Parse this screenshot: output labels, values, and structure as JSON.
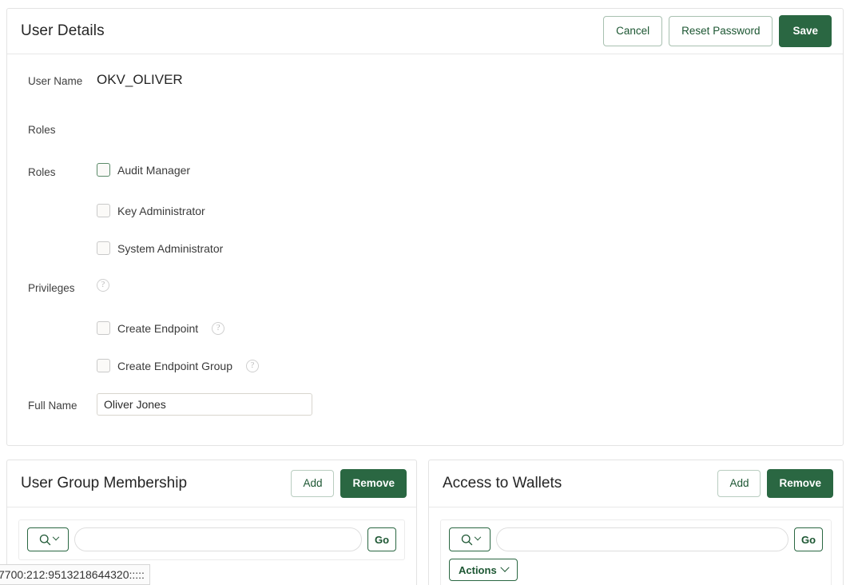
{
  "user_details": {
    "title": "User Details",
    "buttons": {
      "cancel": "Cancel",
      "reset_password": "Reset Password",
      "save": "Save"
    },
    "fields": {
      "user_name_label": "User Name",
      "user_name_value": "OKV_OLIVER",
      "roles_section_label": "Roles",
      "roles_label": "Roles",
      "privileges_label": "Privileges",
      "full_name_label": "Full Name",
      "full_name_value": "Oliver Jones",
      "full_name_placeholder": ""
    },
    "roles": [
      {
        "label": "Audit Manager",
        "checked": false,
        "focused": true
      },
      {
        "label": "Key Administrator",
        "checked": false,
        "focused": false
      },
      {
        "label": "System Administrator",
        "checked": false,
        "focused": false
      }
    ],
    "privileges": [
      {
        "label": "Create Endpoint",
        "checked": false,
        "help": "?"
      },
      {
        "label": "Create Endpoint Group",
        "checked": false,
        "help": "?"
      }
    ],
    "help_glyph": "?"
  },
  "user_group_membership": {
    "title": "User Group Membership",
    "buttons": {
      "add": "Add",
      "remove": "Remove",
      "go": "Go"
    },
    "search": {
      "value": "",
      "placeholder": ""
    }
  },
  "access_to_wallets": {
    "title": "Access to Wallets",
    "buttons": {
      "add": "Add",
      "remove": "Remove",
      "go": "Go",
      "actions": "Actions"
    },
    "search": {
      "value": "",
      "placeholder": ""
    }
  },
  "status_tooltip": {
    "text": "7700:212:9513218644320:::::"
  },
  "colors": {
    "accent_green": "#2a6742",
    "accent_green_text": "#1c5632",
    "border": "#e3e3e3"
  }
}
